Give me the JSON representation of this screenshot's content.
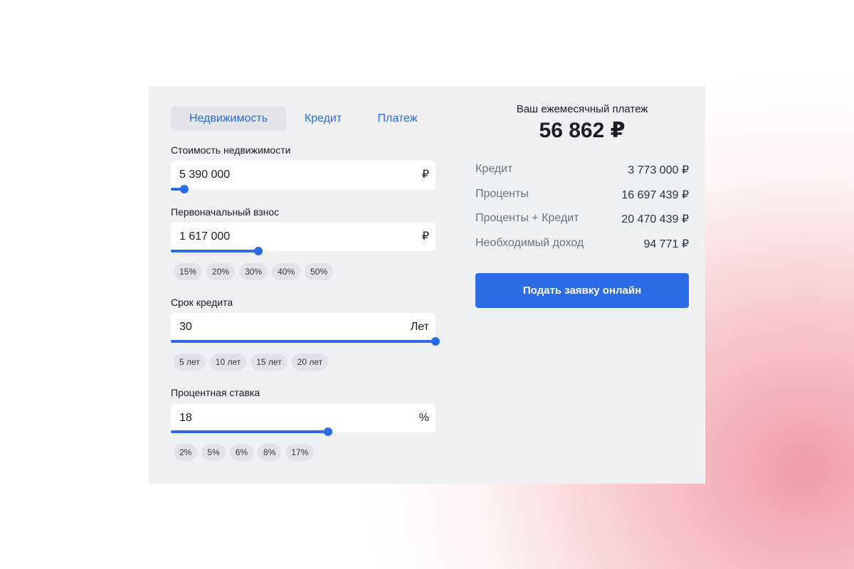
{
  "tabs": [
    "Недвижимость",
    "Кредит",
    "Платеж"
  ],
  "fields": {
    "price": {
      "label": "Стоимость недвижимости",
      "value": "5 390 000",
      "unit": "₽",
      "slider_fraction": 0.05
    },
    "down_payment": {
      "label": "Первоначальный взнос",
      "value": "1 617 000",
      "unit": "₽",
      "slider_fraction": 0.33,
      "chips": [
        "15%",
        "20%",
        "30%",
        "40%",
        "50%"
      ]
    },
    "term": {
      "label": "Срок кредита",
      "value": "30",
      "unit": "Лет",
      "slider_fraction": 1.0,
      "chips": [
        "5 лет",
        "10 лет",
        "15 лет",
        "20 лет"
      ]
    },
    "rate": {
      "label": "Процентная ставка",
      "value": "18",
      "unit": "%",
      "slider_fraction": 0.595,
      "chips": [
        "2%",
        "5%",
        "6%",
        "8%",
        "17%"
      ]
    }
  },
  "result": {
    "payment_label": "Ваш ежемесячный платеж",
    "payment_value": "56 862 ₽",
    "rows": [
      {
        "label": "Кредит",
        "value": "3 773 000 ₽"
      },
      {
        "label": "Проценты",
        "value": "16 697 439 ₽"
      },
      {
        "label": "Проценты + Кредит",
        "value": "20 470 439 ₽"
      },
      {
        "label": "Необходимый доход",
        "value": "94 771 ₽"
      }
    ],
    "cta_label": "Подать заявку онлайн"
  },
  "colors": {
    "accent": "#2b6be6",
    "card_bg": "#eff0f2"
  }
}
